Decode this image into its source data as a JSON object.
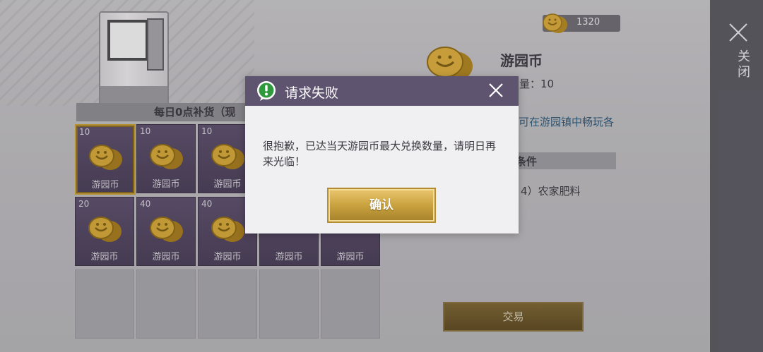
{
  "currency": {
    "icon": "coin-icon",
    "amount": "1320"
  },
  "side_close": {
    "label": "关闭",
    "icon": "close-icon"
  },
  "restock_banner": {
    "text": "每日0点补货（现"
  },
  "items": [
    {
      "qty": "10",
      "name": "游园币",
      "selected": true
    },
    {
      "qty": "10",
      "name": "游园币"
    },
    {
      "qty": "10",
      "name": "游园币"
    },
    {
      "qty": "20",
      "name": "游园币"
    },
    {
      "qty": "40",
      "name": "游园币"
    },
    {
      "qty": "40",
      "name": "游园币"
    },
    {
      "qty": "",
      "name": "游园币"
    },
    {
      "qty": "",
      "name": "游园币"
    }
  ],
  "detail": {
    "title": "游园币",
    "qty": "量：10",
    "desc": "可在游园镇中畅玩各",
    "cond": "条件",
    "req": "4）农家肥料",
    "trade_label": "交易"
  },
  "dialog": {
    "title": "请求失败",
    "message": "很抱歉，已达当天游园币最大兑换数量，请明日再来光临！",
    "confirm_label": "确认"
  },
  "colors": {
    "dialog_header": "#5f5470",
    "gold": "#c9a23f",
    "slot": "#4a3e58",
    "warn_green": "#2f9a3d"
  }
}
